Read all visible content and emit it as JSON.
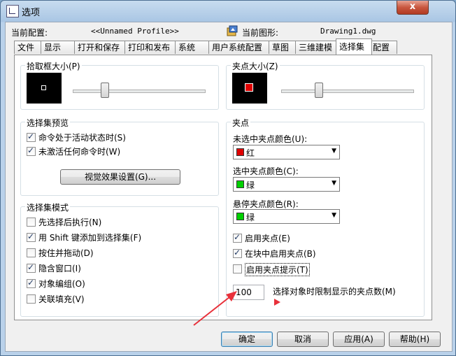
{
  "window": {
    "title": "选项",
    "close_glyph": "x"
  },
  "profile": {
    "label": "当前配置:",
    "value": "<<Unnamed Profile>>"
  },
  "drawing": {
    "label": "当前图形:",
    "value": "Drawing1.dwg"
  },
  "tabs": [
    {
      "label": "文件"
    },
    {
      "label": "显示"
    },
    {
      "label": "打开和保存"
    },
    {
      "label": "打印和发布"
    },
    {
      "label": "系统"
    },
    {
      "label": "用户系统配置"
    },
    {
      "label": "草图"
    },
    {
      "label": "三维建模"
    },
    {
      "label": "选择集"
    },
    {
      "label": "配置"
    }
  ],
  "pickbox": {
    "title": "拾取框大小(P)",
    "level": 0.24
  },
  "gripsize": {
    "title": "夹点大小(Z)",
    "level": 0.28
  },
  "preview": {
    "title": "选择集预览",
    "active_cmd": "命令处于活动状态时(S)",
    "no_cmd": "未激活任何命令时(W)",
    "visual_button": "视觉效果设置(G)..."
  },
  "modes": {
    "title": "选择集模式",
    "items": [
      {
        "label": "先选择后执行(N)",
        "checked": false
      },
      {
        "label": "用 Shift 键添加到选择集(F)",
        "checked": true
      },
      {
        "label": "按住并拖动(D)",
        "checked": false
      },
      {
        "label": "隐含窗口(I)",
        "checked": true
      },
      {
        "label": "对象编组(O)",
        "checked": true
      },
      {
        "label": "关联填充(V)",
        "checked": false
      }
    ]
  },
  "grips": {
    "title": "夹点",
    "unselected": {
      "label": "未选中夹点颜色(U):",
      "value": "红",
      "color": "#e00000"
    },
    "selected": {
      "label": "选中夹点颜色(C):",
      "value": "绿",
      "color": "#00d000"
    },
    "hover": {
      "label": "悬停夹点颜色(R):",
      "value": "绿",
      "color": "#00d000"
    },
    "enable": {
      "label": "启用夹点(E)",
      "checked": true
    },
    "in_blocks": {
      "label": "在块中启用夹点(B)",
      "checked": true
    },
    "tips": {
      "label": "启用夹点提示(T)",
      "checked": false
    },
    "limit_value": "100",
    "limit_label": "选择对象时限制显示的夹点数(M)"
  },
  "buttons": {
    "ok": "确定",
    "cancel": "取消",
    "apply": "应用(A)",
    "help": "帮助(H)"
  },
  "colors": {
    "annotation_red": "#e8303a",
    "tab_active": "#ffffff"
  }
}
